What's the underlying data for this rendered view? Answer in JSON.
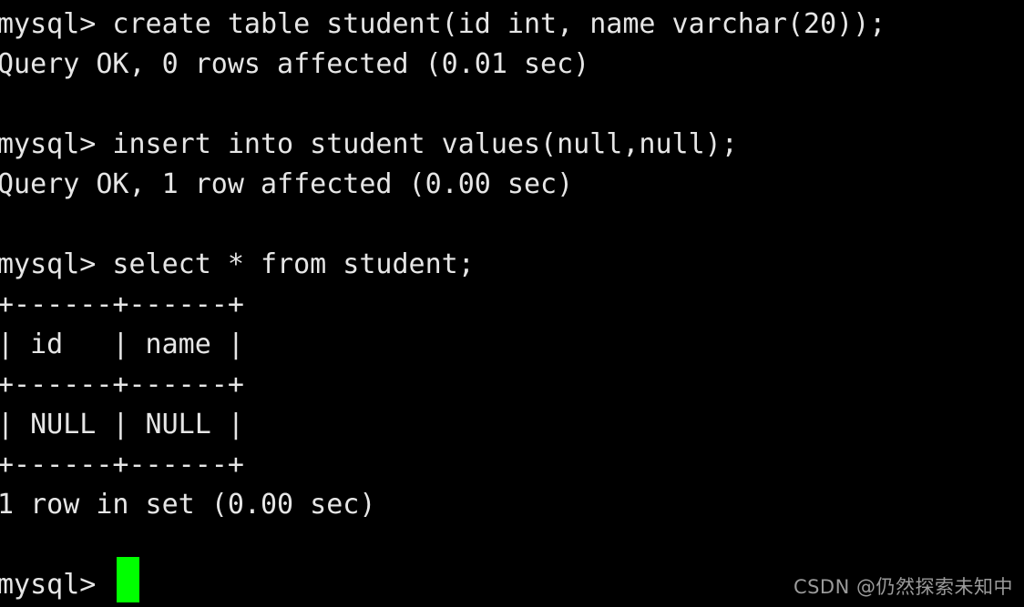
{
  "terminal": {
    "title": "mysql command line client",
    "background_color": "#000000",
    "text_color": "#e6e6e6",
    "cursor_color": "#00ff00",
    "prompt": "mysql> ",
    "lines": [
      "mysql> create table student(id int, name varchar(20));",
      "Query OK, 0 rows affected (0.01 sec)",
      "",
      "mysql> insert into student values(null,null);",
      "Query OK, 1 row affected (0.00 sec)",
      "",
      "mysql> select * from student;",
      "+------+------+",
      "| id   | name |",
      "+------+------+",
      "| NULL | NULL |",
      "+------+------+",
      "1 row in set (0.00 sec)",
      "",
      "mysql> "
    ],
    "commands": [
      "create table student(id int, name varchar(20));",
      "insert into student values(null,null);",
      "select * from student;"
    ],
    "results": [
      "Query OK, 0 rows affected (0.01 sec)",
      "Query OK, 1 row affected (0.00 sec)",
      "1 row in set (0.00 sec)"
    ],
    "result_table": {
      "border": "+------+------+",
      "columns": [
        "id",
        "name"
      ],
      "rows": [
        [
          "NULL",
          "NULL"
        ]
      ],
      "row_count_text": "1 row in set (0.00 sec)"
    },
    "cursor": {
      "visible": true,
      "shape": "block",
      "color": "#00ff00"
    }
  },
  "watermark": {
    "text": "CSDN @仍然探索未知中",
    "color": "#9b9b9b"
  }
}
